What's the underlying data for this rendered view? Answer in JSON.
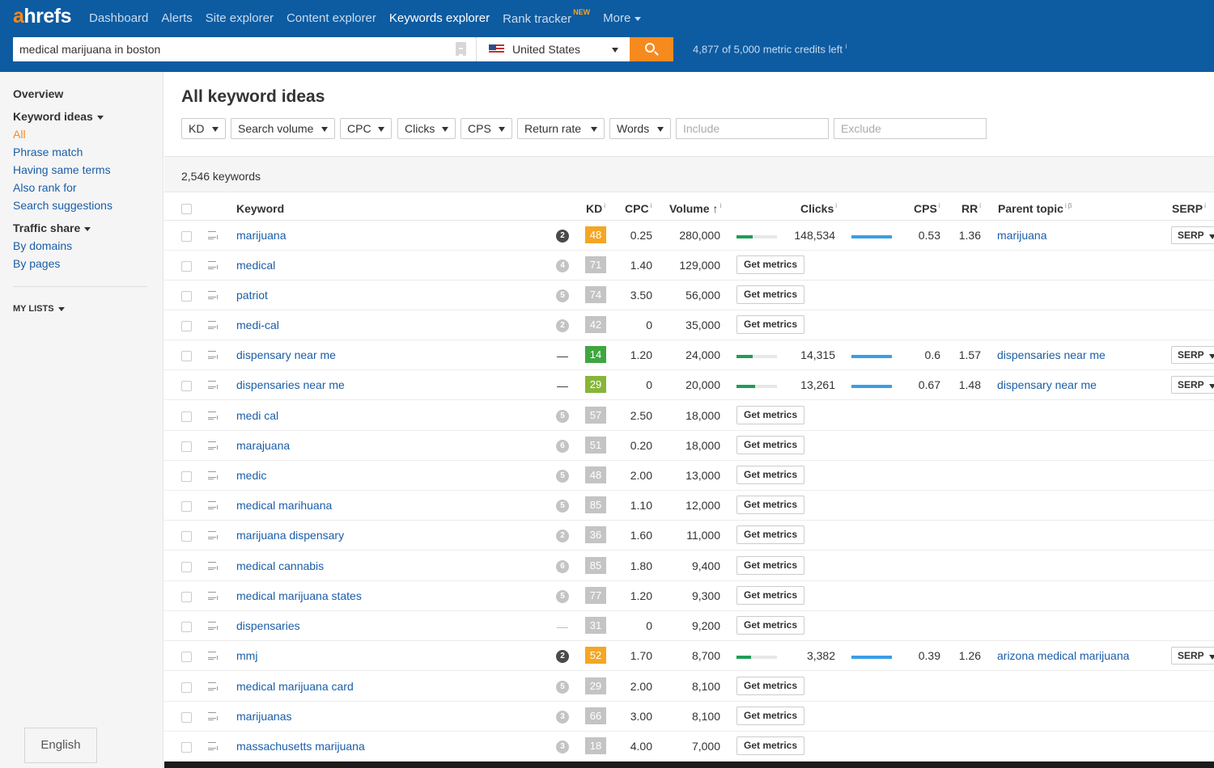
{
  "header": {
    "logo_a": "a",
    "logo_rest": "hrefs",
    "nav": [
      {
        "label": "Dashboard"
      },
      {
        "label": "Alerts"
      },
      {
        "label": "Site explorer"
      },
      {
        "label": "Content explorer"
      },
      {
        "label": "Keywords explorer",
        "active": true
      },
      {
        "label": "Rank tracker",
        "badge": "NEW"
      },
      {
        "label": "More"
      }
    ],
    "search_value": "medical marijuana in boston",
    "country": "United States",
    "credits": "4,877 of 5,000 metric credits left",
    "credits_info": "i"
  },
  "sidebar": {
    "overview": "Overview",
    "keyword_ideas": "Keyword ideas",
    "keyword_links": [
      "All",
      "Phrase match",
      "Having same terms",
      "Also rank for",
      "Search suggestions"
    ],
    "traffic_share": "Traffic share",
    "traffic_links": [
      "By domains",
      "By pages"
    ],
    "my_lists": "MY LISTS",
    "language": "English"
  },
  "main": {
    "title": "All keyword ideas",
    "filters": [
      "KD",
      "Search volume",
      "CPC",
      "Clicks",
      "CPS",
      "Return rate",
      "Words"
    ],
    "include_placeholder": "Include",
    "exclude_placeholder": "Exclude",
    "keyword_count": "2,546 keywords",
    "columns": {
      "keyword": "Keyword",
      "kd": "KD",
      "cpc": "CPC",
      "volume": "Volume",
      "clicks": "Clicks",
      "cps": "CPS",
      "rr": "RR",
      "parent_topic": "Parent topic",
      "serp": "SERP",
      "info": "i",
      "beta": "β",
      "sort_arrow": "↑"
    },
    "get_metrics_label": "Get metrics",
    "serp_label": "SERP",
    "rows": [
      {
        "keyword": "marijuana",
        "serp_features": "2",
        "sf_style": "dark",
        "kd": "48",
        "kd_color": "orange",
        "cpc": "0.25",
        "volume": "280,000",
        "clicks": "148,534",
        "clicks_frac": 0.4,
        "cps": "0.53",
        "rr": "1.36",
        "parent": "marijuana"
      },
      {
        "keyword": "medical",
        "serp_features": "4",
        "sf_style": "gray",
        "kd": "71",
        "kd_color": "gray",
        "cpc": "1.40",
        "volume": "129,000"
      },
      {
        "keyword": "patriot",
        "serp_features": "5",
        "sf_style": "gray",
        "kd": "74",
        "kd_color": "gray",
        "cpc": "3.50",
        "volume": "56,000"
      },
      {
        "keyword": "medi-cal",
        "serp_features": "2",
        "sf_style": "gray",
        "kd": "42",
        "kd_color": "gray",
        "cpc": "0",
        "volume": "35,000"
      },
      {
        "keyword": "dispensary near me",
        "serp_features": "—",
        "sf_style": "dash",
        "kd": "14",
        "kd_color": "green",
        "cpc": "1.20",
        "volume": "24,000",
        "clicks": "14,315",
        "clicks_frac": 0.4,
        "cps": "0.6",
        "rr": "1.57",
        "parent": "dispensaries near me"
      },
      {
        "keyword": "dispensaries near me",
        "serp_features": "—",
        "sf_style": "dash",
        "kd": "29",
        "kd_color": "lgreen",
        "cpc": "0",
        "volume": "20,000",
        "clicks": "13,261",
        "clicks_frac": 0.45,
        "cps": "0.67",
        "rr": "1.48",
        "parent": "dispensary near me"
      },
      {
        "keyword": "medi cal",
        "serp_features": "5",
        "sf_style": "gray",
        "kd": "57",
        "kd_color": "gray",
        "cpc": "2.50",
        "volume": "18,000"
      },
      {
        "keyword": "marajuana",
        "serp_features": "6",
        "sf_style": "gray",
        "kd": "51",
        "kd_color": "gray",
        "cpc": "0.20",
        "volume": "18,000"
      },
      {
        "keyword": "medic",
        "serp_features": "5",
        "sf_style": "gray",
        "kd": "48",
        "kd_color": "gray",
        "cpc": "2.00",
        "volume": "13,000"
      },
      {
        "keyword": "medical marihuana",
        "serp_features": "5",
        "sf_style": "gray",
        "kd": "85",
        "kd_color": "gray",
        "cpc": "1.10",
        "volume": "12,000"
      },
      {
        "keyword": "marijuana dispensary",
        "serp_features": "2",
        "sf_style": "gray",
        "kd": "36",
        "kd_color": "gray",
        "cpc": "1.60",
        "volume": "11,000"
      },
      {
        "keyword": "medical cannabis",
        "serp_features": "6",
        "sf_style": "gray",
        "kd": "85",
        "kd_color": "gray",
        "cpc": "1.80",
        "volume": "9,400"
      },
      {
        "keyword": "medical marijuana states",
        "serp_features": "5",
        "sf_style": "gray",
        "kd": "77",
        "kd_color": "gray",
        "cpc": "1.20",
        "volume": "9,300"
      },
      {
        "keyword": "dispensaries",
        "serp_features": "—",
        "sf_style": "dashlight",
        "kd": "31",
        "kd_color": "gray",
        "cpc": "0",
        "volume": "9,200"
      },
      {
        "keyword": "mmj",
        "serp_features": "2",
        "sf_style": "dark",
        "kd": "52",
        "kd_color": "orange",
        "cpc": "1.70",
        "volume": "8,700",
        "clicks": "3,382",
        "clicks_frac": 0.35,
        "cps": "0.39",
        "rr": "1.26",
        "parent": "arizona medical marijuana"
      },
      {
        "keyword": "medical marijuana card",
        "serp_features": "5",
        "sf_style": "gray",
        "kd": "29",
        "kd_color": "gray",
        "cpc": "2.00",
        "volume": "8,100"
      },
      {
        "keyword": "marijuanas",
        "serp_features": "3",
        "sf_style": "gray",
        "kd": "66",
        "kd_color": "gray",
        "cpc": "3.00",
        "volume": "8,100"
      },
      {
        "keyword": "massachusetts marijuana",
        "serp_features": "3",
        "sf_style": "gray",
        "kd": "18",
        "kd_color": "gray",
        "cpc": "4.00",
        "volume": "7,000"
      }
    ]
  },
  "colors": {
    "header_bg": "#0d5ba1",
    "accent_orange": "#f68a1f",
    "link_blue": "#1a5ea8",
    "kd_orange": "#f5a623",
    "kd_green": "#3fa63f",
    "kd_light_green": "#87b53a",
    "kd_gray": "#c4c4c4",
    "clicks_green": "#1f9d55",
    "cps_blue": "#3a9ee5"
  }
}
